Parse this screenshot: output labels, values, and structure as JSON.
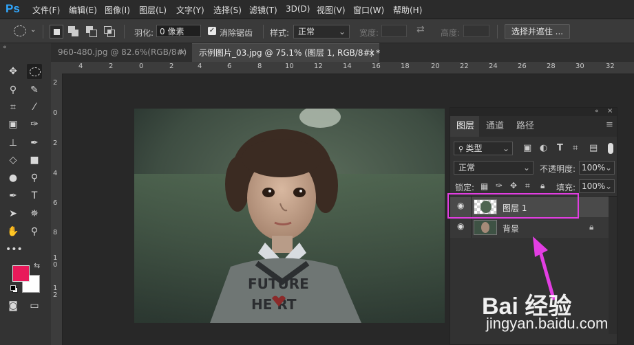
{
  "app": {
    "logo": "Ps"
  },
  "menu": [
    "文件(F)",
    "编辑(E)",
    "图像(I)",
    "图层(L)",
    "文字(Y)",
    "选择(S)",
    "滤镜(T)",
    "3D(D)",
    "视图(V)",
    "窗口(W)",
    "帮助(H)"
  ],
  "options": {
    "feather_label": "羽化:",
    "feather_value": "0 像素",
    "antialias_label": "消除锯齿",
    "style_label": "样式:",
    "style_value": "正常",
    "width_label": "宽度:",
    "height_label": "高度:",
    "select_mask_button": "选择并遮住 ..."
  },
  "tabs": [
    {
      "title": "960-480.jpg @ 82.6%(RGB/8#)",
      "close": "×"
    },
    {
      "title": "示例图片_03.jpg @ 75.1% (图层 1, RGB/8#) *",
      "close": "×"
    }
  ],
  "ruler_top": [
    "4",
    "2",
    "0",
    "2",
    "4",
    "6",
    "8",
    "10",
    "12",
    "14",
    "16",
    "18",
    "20",
    "22",
    "24",
    "26",
    "28",
    "30",
    "32"
  ],
  "ruler_left": [
    "2",
    "0",
    "2",
    "4",
    "6",
    "8",
    "1\n0",
    "1\n2"
  ],
  "photo_text": "FUTURE HEART",
  "layers_panel": {
    "collapse": "«",
    "close": "×",
    "tabs": [
      "图层",
      "通道",
      "路径"
    ],
    "filter_kind": "类型",
    "blend_mode": "正常",
    "opacity_label": "不透明度:",
    "opacity_value": "100%",
    "lock_label": "锁定:",
    "fill_label": "填充:",
    "fill_value": "100%",
    "layers": [
      {
        "name": "图层 1"
      },
      {
        "name": "背景"
      }
    ]
  },
  "watermark": {
    "brand": "Bai 经验",
    "url": "jingyan.baidu.com"
  },
  "colors": {
    "foreground": "#e8195a",
    "background": "#ffffff",
    "highlight": "#e33ee3",
    "ps_blue": "#31a8ff"
  }
}
